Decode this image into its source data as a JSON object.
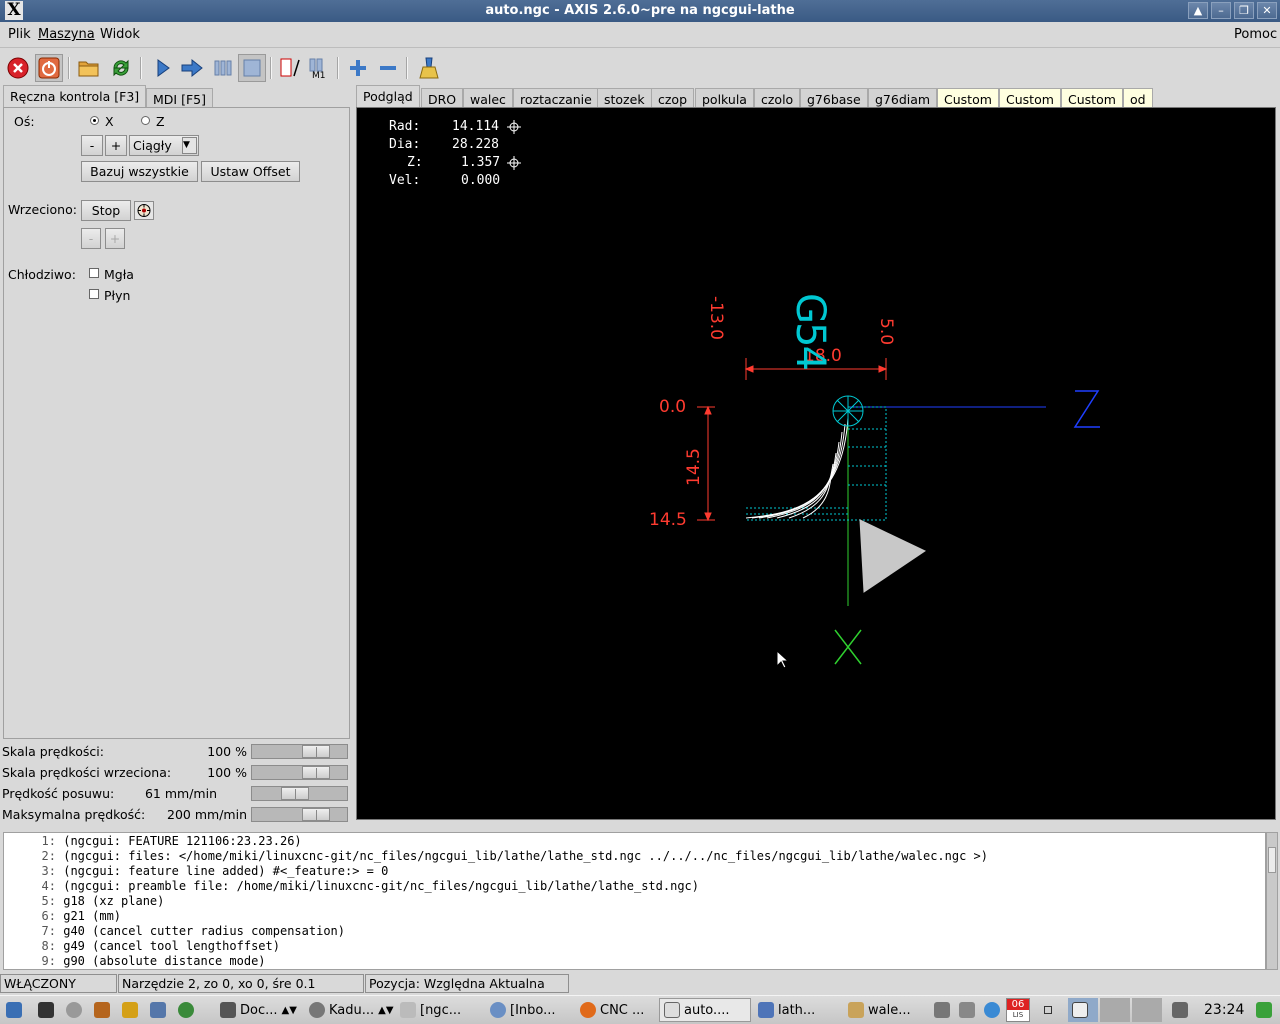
{
  "window": {
    "title": "auto.ngc - AXIS 2.6.0~pre na ngcgui-lathe",
    "logo": "X"
  },
  "menu": {
    "items": [
      "Plik",
      "Maszyna",
      "Widok"
    ],
    "help": "Pomoc"
  },
  "left_tabs": [
    "Ręczna kontrola [F3]",
    "MDI [F5]"
  ],
  "manual": {
    "axis_label": "Oś:",
    "axis_x": "X",
    "axis_z": "Z",
    "jog_minus": "-",
    "jog_plus": "+",
    "jog_mode": "Ciągły",
    "home_all": "Bazuj wszystkie",
    "set_offset": "Ustaw Offset",
    "spindle_label": "Wrzeciono:",
    "spindle_stop": "Stop",
    "spindle_minus": "-",
    "spindle_plus": "+",
    "coolant_label": "Chłodziwo:",
    "mist": "Mgła",
    "flood": "Płyn"
  },
  "sliders": [
    {
      "label": "Skala prędkości:",
      "value": "100 %",
      "position": 0.75
    },
    {
      "label": "Skala prędkości wrzeciona:",
      "value": "100 %",
      "position": 0.75
    },
    {
      "label": "Prędkość posuwu:",
      "value": "61 mm/min",
      "position": 0.44
    },
    {
      "label": "Maksymalna prędkość:",
      "value": "200 mm/min",
      "position": 0.75
    }
  ],
  "right_tabs": [
    "Podgląd",
    "DRO",
    "walec",
    "roztaczanie",
    "stozek",
    "czop",
    "polkula",
    "czolo",
    "g76base",
    "g76diam",
    "Custom",
    "Custom",
    "Custom",
    "od"
  ],
  "dro": [
    {
      "label": "Rad:",
      "value": "14.114"
    },
    {
      "label": "Dia:",
      "value": "28.228"
    },
    {
      "label": "Z:",
      "value": "1.357"
    },
    {
      "label": "Vel:",
      "value": "0.000"
    }
  ],
  "preview": {
    "dim_x_left": "-13.0",
    "dim_x_right": "5.0",
    "dim_x_width": "18.0",
    "dim_z_top": "0.0",
    "dim_z_height": "14.5",
    "dim_z_bottom": "14.5",
    "cyan_label": "G54",
    "axis_z_label": "Z",
    "axis_x_label": "X",
    "colors": {
      "dims": "#ff3b30",
      "cyan": "#00c8d2",
      "z_axis": "#1f3fff",
      "x_axis": "#2fd02f",
      "tool": "#c8c8c8",
      "path": "#ffffff"
    }
  },
  "gcode_lines": [
    {
      "num": "1:",
      "text": "(ngcgui: FEATURE 121106:23.23.26)"
    },
    {
      "num": "2:",
      "text": "(ngcgui: files: </home/miki/linuxcnc-git/nc_files/ngcgui_lib/lathe/lathe_std.ngc ../../../nc_files/ngcgui_lib/lathe/walec.ngc >)"
    },
    {
      "num": "3:",
      "text": "(ngcgui: feature line added) #<_feature:> = 0"
    },
    {
      "num": "4:",
      "text": "(ngcgui: preamble file: /home/miki/linuxcnc-git/nc_files/ngcgui_lib/lathe/lathe_std.ngc)"
    },
    {
      "num": "5:",
      "text": "g18 (xz plane)"
    },
    {
      "num": "6:",
      "text": "g21 (mm)"
    },
    {
      "num": "7:",
      "text": "g40 (cancel cutter radius compensation)"
    },
    {
      "num": "8:",
      "text": "g49 (cancel tool lengthoffset)"
    },
    {
      "num": "9:",
      "text": "g90 (absolute distance mode)"
    }
  ],
  "status": {
    "machine": "WŁĄCZONY",
    "tool": "Narzędzie 2, zo 0, xo 0, śre 0.1",
    "position": "Pozycja: Względna Aktualna"
  },
  "taskbar": {
    "items": [
      "Doc...",
      "Kadu...",
      "[ngc...",
      "[Inbo...",
      "CNC ...",
      "auto....",
      "lath...",
      "wale..."
    ],
    "calendar_day": "06",
    "calendar_month": "LIS",
    "clock": "23:24"
  }
}
